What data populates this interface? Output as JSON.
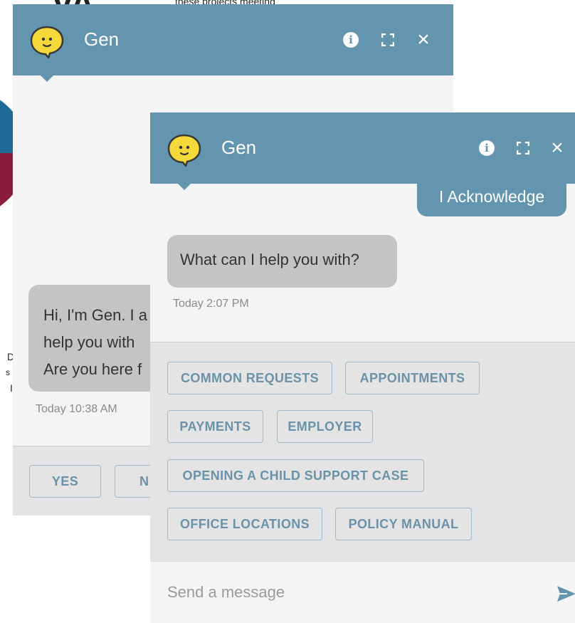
{
  "background_page": {
    "logo_text": "VA",
    "top_text": "these projects meeting",
    "fragments": [
      "D",
      "s",
      "I"
    ]
  },
  "back_window": {
    "title": "Gen",
    "bot_message": "Hi, I'm Gen. I a help you with Are you here f",
    "bot_message_lines": [
      "Hi, I'm Gen. I a",
      "help you with",
      "Are you here f"
    ],
    "timestamp": "Today 10:38 AM",
    "options": [
      "YES",
      "N"
    ]
  },
  "front_window": {
    "title": "Gen",
    "user_message": "I Acknowledge",
    "bot_message": "What can I help you with?",
    "timestamp": "Today 2:07 PM",
    "options": [
      "COMMON REQUESTS",
      "APPOINTMENTS",
      "PAYMENTS",
      "EMPLOYER",
      "OPENING A CHILD SUPPORT CASE",
      "OFFICE LOCATIONS",
      "POLICY MANUAL"
    ],
    "composer_placeholder": "Send a message"
  },
  "icons": {
    "avatar": "chat-bubble-smiley-icon",
    "info": "info-icon",
    "expand": "expand-icon",
    "close": "close-icon",
    "send": "send-icon"
  },
  "colors": {
    "header": "#6495ae",
    "avatar_yellow": "#f5d93a",
    "bot_bubble": "#c4c4c4",
    "chip_text": "#6b92a8",
    "chip_border": "#9cbbcb"
  }
}
